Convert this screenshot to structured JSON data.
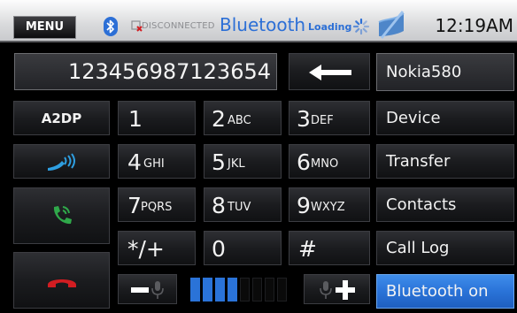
{
  "status_bar": {
    "menu_label": "MENU",
    "connection_status": "DISCONNECTED",
    "title": "Bluetooth",
    "loading_label": "Loading",
    "clock": "12:19AM"
  },
  "dialer": {
    "number": "123456987123654",
    "connected_device": "Nokia580"
  },
  "left_buttons": {
    "a2dp_label": "A2DP"
  },
  "keypad": [
    {
      "main": "1",
      "sub": ""
    },
    {
      "main": "2",
      "sub": "ABC"
    },
    {
      "main": "3",
      "sub": "DEF"
    },
    {
      "main": "4",
      "sub": "GHI"
    },
    {
      "main": "5",
      "sub": "JKL"
    },
    {
      "main": "6",
      "sub": "MNO"
    },
    {
      "main": "7",
      "sub": "PQRS"
    },
    {
      "main": "8",
      "sub": "TUV"
    },
    {
      "main": "9",
      "sub": "WXYZ"
    },
    {
      "main": "*/+",
      "sub": ""
    },
    {
      "main": "0",
      "sub": ""
    },
    {
      "main": "#",
      "sub": ""
    }
  ],
  "right_menu": {
    "device": "Device",
    "transfer": "Transfer",
    "contacts": "Contacts",
    "call_log": "Call Log",
    "bluetooth_on": "Bluetooth on"
  },
  "mic_volume": {
    "level": 4,
    "max": 8
  },
  "icons": {
    "backspace": "backspace-arrow-icon",
    "audio_transfer": "audio-transfer-icon",
    "answer": "answer-call-icon",
    "hangup": "hang-up-icon",
    "mic_down": "mic-volume-down-icon",
    "mic_up": "mic-volume-up-icon"
  },
  "colors": {
    "accent_blue": "#2c6fd6",
    "active_button": "#2a73d8",
    "answer_green": "#2fa84a",
    "hangup_red": "#d21d22",
    "meter_on": "#2a73d8",
    "meter_off": "#0a0a0a"
  }
}
